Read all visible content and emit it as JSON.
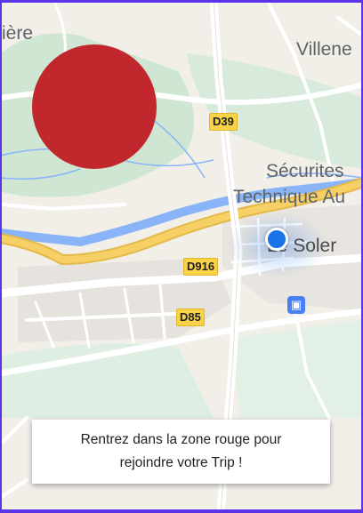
{
  "map": {
    "places": {
      "top_left_fragment": "ière",
      "top_right": "Villene",
      "poi_line1": "Sécurites",
      "poi_line2": "Technique Au",
      "town": "Le Soler"
    },
    "roads": [
      "D39",
      "D916",
      "D85"
    ],
    "colors": {
      "zone": "#c1272d",
      "user_location": "#1a73e8",
      "river": "#8ab4f8",
      "highway": "#f6cf65",
      "frame_accent": "#5b33e8"
    },
    "icons": [
      "red-zone-circle",
      "user-location-dot",
      "train-station-icon"
    ]
  },
  "banner": {
    "line1": "Rentrez dans la zone rouge pour",
    "line2": "rejoindre votre Trip !"
  }
}
